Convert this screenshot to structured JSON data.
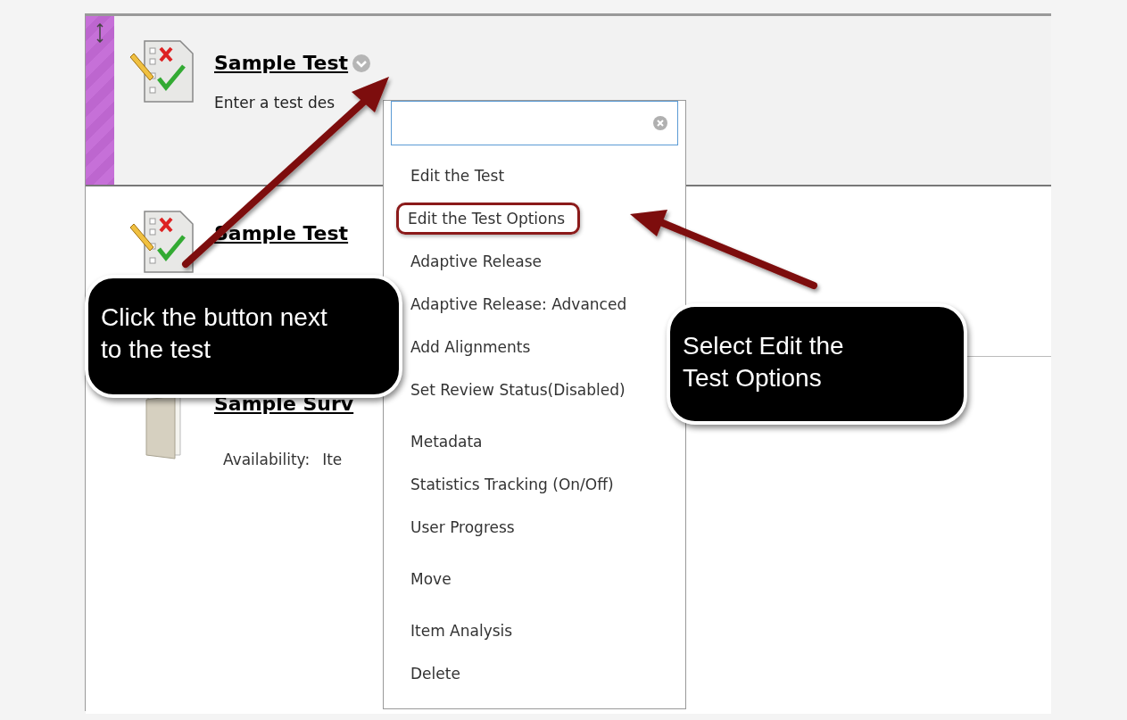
{
  "content_items": [
    {
      "kind": "test",
      "title": "Sample Test",
      "description": "Enter a test des",
      "selected": true
    },
    {
      "kind": "test",
      "title": "Sample Test",
      "selected": false
    },
    {
      "kind": "survey",
      "title": "Sample Surv",
      "availability_label": "Availability:",
      "availability_value": "Ite",
      "selected": false
    }
  ],
  "context_menu": {
    "groups": [
      [
        {
          "label": "Edit the Test",
          "highlighted": false
        },
        {
          "label": "Edit the Test Options",
          "highlighted": true
        },
        {
          "label": "Adaptive Release",
          "highlighted": false
        },
        {
          "label": "Adaptive Release: Advanced",
          "highlighted": false
        },
        {
          "label": "Add Alignments",
          "highlighted": false
        },
        {
          "label": "Set Review Status(Disabled)",
          "highlighted": false
        }
      ],
      [
        {
          "label": "Metadata",
          "highlighted": false
        },
        {
          "label": "Statistics Tracking (On/Off)",
          "highlighted": false
        },
        {
          "label": "User Progress",
          "highlighted": false
        }
      ],
      [
        {
          "label": "Move",
          "highlighted": false
        }
      ],
      [
        {
          "label": "Item Analysis",
          "highlighted": false
        },
        {
          "label": "Delete",
          "highlighted": false
        }
      ]
    ]
  },
  "callouts": [
    "Click the button next to the test",
    "Select Edit the Test Options"
  ]
}
